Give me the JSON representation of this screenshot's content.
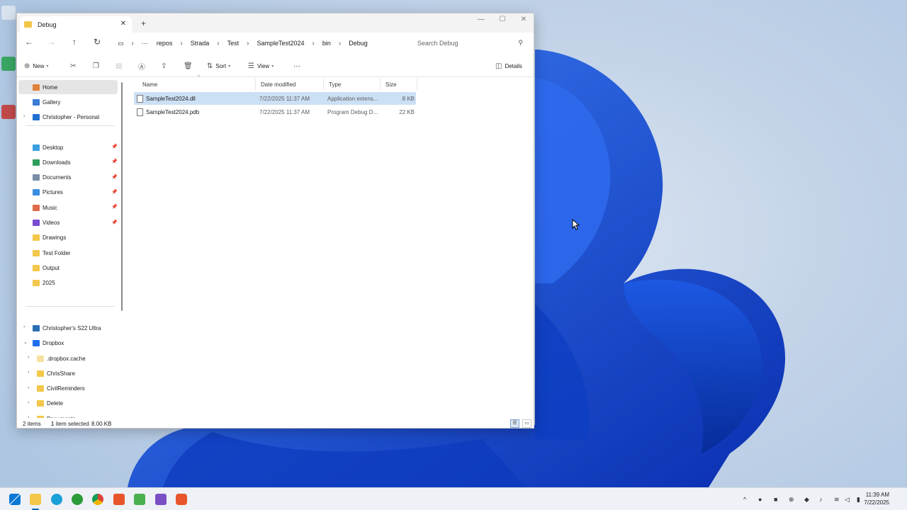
{
  "window": {
    "tab_title": "Debug",
    "tab_close": "✕",
    "new_tab": "+",
    "minimize": "—",
    "maximize": "☐",
    "close": "✕"
  },
  "address": {
    "overflow": "···",
    "breadcrumbs": [
      "repos",
      "Strada",
      "Test",
      "SampleTest2024",
      "bin",
      "Debug"
    ],
    "separator": "›",
    "search_placeholder": "Search Debug"
  },
  "toolbar": {
    "new_label": "New",
    "sort_label": "Sort",
    "view_label": "View",
    "more_label": "···",
    "details_label": "Details"
  },
  "sidebar": {
    "top": [
      {
        "label": "Home",
        "icon": "home-icon",
        "color": "#e0803a"
      },
      {
        "label": "Gallery",
        "icon": "gallery-icon",
        "color": "#3a7bd5"
      },
      {
        "label": "Christopher - Personal",
        "icon": "onedrive-icon",
        "color": "#1f6fd1"
      }
    ],
    "quick": [
      {
        "label": "Desktop",
        "icon": "desktop-icon",
        "color": "#3aa0e0"
      },
      {
        "label": "Downloads",
        "icon": "downloads-icon",
        "color": "#2e9e5b"
      },
      {
        "label": "Documents",
        "icon": "documents-icon",
        "color": "#7a8ea8"
      },
      {
        "label": "Pictures",
        "icon": "pictures-icon",
        "color": "#3a8ee0"
      },
      {
        "label": "Music",
        "icon": "music-icon",
        "color": "#e06a4a"
      },
      {
        "label": "Videos",
        "icon": "videos-icon",
        "color": "#7a4ad0"
      },
      {
        "label": "Drawings",
        "icon": "folder-icon",
        "color": "#f4c74a"
      },
      {
        "label": "Test Folder",
        "icon": "folder-icon",
        "color": "#f4c74a"
      },
      {
        "label": "Output",
        "icon": "folder-icon",
        "color": "#f4c74a"
      },
      {
        "label": "2025",
        "icon": "folder-icon",
        "color": "#f4c74a"
      }
    ],
    "devices": [
      {
        "label": "Christopher's S22 Ultra",
        "icon": "phone-icon",
        "color": "#2a6fb5"
      },
      {
        "label": "Dropbox",
        "icon": "dropbox-icon",
        "color": "#1e6ff0"
      }
    ],
    "dropbox_children": [
      {
        "label": ".dropbox.cache",
        "icon": "folder-icon",
        "color": "#f7e0a0"
      },
      {
        "label": "ChrisShare",
        "icon": "folder-icon",
        "color": "#f4c74a"
      },
      {
        "label": "CivilReminders",
        "icon": "folder-icon",
        "color": "#f4c74a"
      },
      {
        "label": "Delete",
        "icon": "folder-icon",
        "color": "#f4c74a"
      },
      {
        "label": "Documents",
        "icon": "folder-icon",
        "color": "#f4c74a"
      }
    ]
  },
  "table": {
    "columns": [
      "Name",
      "Date modified",
      "Type",
      "Size"
    ],
    "rows": [
      {
        "name": "SampleTest2024.dll",
        "date": "7/22/2025 11:37 AM",
        "type": "Application extens...",
        "size": "8 KB",
        "selected": true
      },
      {
        "name": "SampleTest2024.pdb",
        "date": "7/22/2025 11:37 AM",
        "type": "Program Debug D...",
        "size": "22 KB",
        "selected": false
      }
    ]
  },
  "status": {
    "items_count": "2 items",
    "selection": "1 item selected",
    "selection_size": "8.00 KB"
  },
  "taskbar": {
    "time": "11:39 AM",
    "date": "7/22/2025"
  },
  "colors": {
    "accent": "#0067c0",
    "folder": "#f4c74a",
    "selection": "#cce0f5"
  }
}
